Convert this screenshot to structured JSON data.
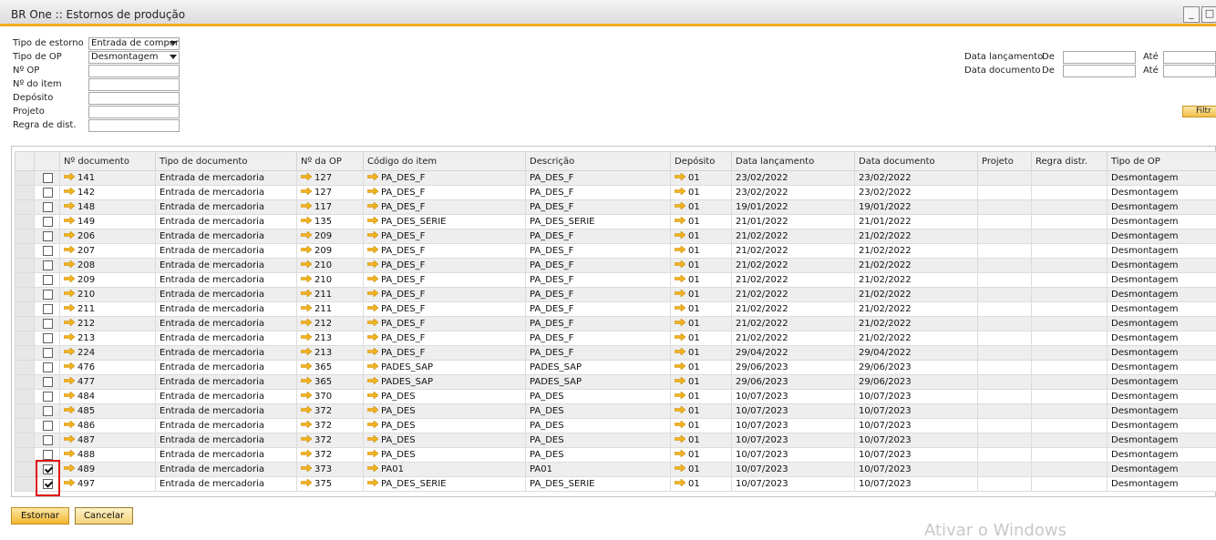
{
  "window": {
    "title": "BR One :: Estornos de produção",
    "minimize_label": "_",
    "maximize_label": "□"
  },
  "form": {
    "tipo_estorno": {
      "label": "Tipo de estorno",
      "value": "Entrada de compor"
    },
    "tipo_op": {
      "label": "Tipo de OP",
      "value": "Desmontagem"
    },
    "num_op": {
      "label": "Nº OP",
      "value": ""
    },
    "num_item": {
      "label": "Nº do item",
      "value": ""
    },
    "deposito": {
      "label": "Depósito",
      "value": ""
    },
    "projeto": {
      "label": "Projeto",
      "value": ""
    },
    "regra_dist": {
      "label": "Regra de dist.",
      "value": ""
    },
    "data_lancamento": {
      "label": "Data lançamento",
      "de": "De",
      "ate": "Até"
    },
    "data_documento": {
      "label": "Data documento",
      "de": "De",
      "ate": "Até"
    },
    "filter_label": "Filtr"
  },
  "grid": {
    "columns": [
      "Nº documento",
      "Tipo de documento",
      "Nº da OP",
      "Código do item",
      "Descrição",
      "Depósito",
      "Data lançamento",
      "Data documento",
      "Projeto",
      "Regra distr.",
      "Tipo de OP"
    ],
    "rows": [
      {
        "checked": false,
        "doc": "141",
        "tipo": "Entrada de mercadoria",
        "op": "127",
        "codigo": "PA_DES_F",
        "descricao": "PA_DES_F",
        "deposito": "01",
        "data_lanc": "23/02/2022",
        "data_doc": "23/02/2022",
        "projeto": "",
        "regra": "",
        "tipo_op": "Desmontagem"
      },
      {
        "checked": false,
        "doc": "142",
        "tipo": "Entrada de mercadoria",
        "op": "127",
        "codigo": "PA_DES_F",
        "descricao": "PA_DES_F",
        "deposito": "01",
        "data_lanc": "23/02/2022",
        "data_doc": "23/02/2022",
        "projeto": "",
        "regra": "",
        "tipo_op": "Desmontagem"
      },
      {
        "checked": false,
        "doc": "148",
        "tipo": "Entrada de mercadoria",
        "op": "117",
        "codigo": "PA_DES_F",
        "descricao": "PA_DES_F",
        "deposito": "01",
        "data_lanc": "19/01/2022",
        "data_doc": "19/01/2022",
        "projeto": "",
        "regra": "",
        "tipo_op": "Desmontagem"
      },
      {
        "checked": false,
        "doc": "149",
        "tipo": "Entrada de mercadoria",
        "op": "135",
        "codigo": "PA_DES_SERIE",
        "descricao": "PA_DES_SERIE",
        "deposito": "01",
        "data_lanc": "21/01/2022",
        "data_doc": "21/01/2022",
        "projeto": "",
        "regra": "",
        "tipo_op": "Desmontagem"
      },
      {
        "checked": false,
        "doc": "206",
        "tipo": "Entrada de mercadoria",
        "op": "209",
        "codigo": "PA_DES_F",
        "descricao": "PA_DES_F",
        "deposito": "01",
        "data_lanc": "21/02/2022",
        "data_doc": "21/02/2022",
        "projeto": "",
        "regra": "",
        "tipo_op": "Desmontagem"
      },
      {
        "checked": false,
        "doc": "207",
        "tipo": "Entrada de mercadoria",
        "op": "209",
        "codigo": "PA_DES_F",
        "descricao": "PA_DES_F",
        "deposito": "01",
        "data_lanc": "21/02/2022",
        "data_doc": "21/02/2022",
        "projeto": "",
        "regra": "",
        "tipo_op": "Desmontagem"
      },
      {
        "checked": false,
        "doc": "208",
        "tipo": "Entrada de mercadoria",
        "op": "210",
        "codigo": "PA_DES_F",
        "descricao": "PA_DES_F",
        "deposito": "01",
        "data_lanc": "21/02/2022",
        "data_doc": "21/02/2022",
        "projeto": "",
        "regra": "",
        "tipo_op": "Desmontagem"
      },
      {
        "checked": false,
        "doc": "209",
        "tipo": "Entrada de mercadoria",
        "op": "210",
        "codigo": "PA_DES_F",
        "descricao": "PA_DES_F",
        "deposito": "01",
        "data_lanc": "21/02/2022",
        "data_doc": "21/02/2022",
        "projeto": "",
        "regra": "",
        "tipo_op": "Desmontagem"
      },
      {
        "checked": false,
        "doc": "210",
        "tipo": "Entrada de mercadoria",
        "op": "211",
        "codigo": "PA_DES_F",
        "descricao": "PA_DES_F",
        "deposito": "01",
        "data_lanc": "21/02/2022",
        "data_doc": "21/02/2022",
        "projeto": "",
        "regra": "",
        "tipo_op": "Desmontagem"
      },
      {
        "checked": false,
        "doc": "211",
        "tipo": "Entrada de mercadoria",
        "op": "211",
        "codigo": "PA_DES_F",
        "descricao": "PA_DES_F",
        "deposito": "01",
        "data_lanc": "21/02/2022",
        "data_doc": "21/02/2022",
        "projeto": "",
        "regra": "",
        "tipo_op": "Desmontagem"
      },
      {
        "checked": false,
        "doc": "212",
        "tipo": "Entrada de mercadoria",
        "op": "212",
        "codigo": "PA_DES_F",
        "descricao": "PA_DES_F",
        "deposito": "01",
        "data_lanc": "21/02/2022",
        "data_doc": "21/02/2022",
        "projeto": "",
        "regra": "",
        "tipo_op": "Desmontagem"
      },
      {
        "checked": false,
        "doc": "213",
        "tipo": "Entrada de mercadoria",
        "op": "213",
        "codigo": "PA_DES_F",
        "descricao": "PA_DES_F",
        "deposito": "01",
        "data_lanc": "21/02/2022",
        "data_doc": "21/02/2022",
        "projeto": "",
        "regra": "",
        "tipo_op": "Desmontagem"
      },
      {
        "checked": false,
        "doc": "224",
        "tipo": "Entrada de mercadoria",
        "op": "213",
        "codigo": "PA_DES_F",
        "descricao": "PA_DES_F",
        "deposito": "01",
        "data_lanc": "29/04/2022",
        "data_doc": "29/04/2022",
        "projeto": "",
        "regra": "",
        "tipo_op": "Desmontagem"
      },
      {
        "checked": false,
        "doc": "476",
        "tipo": "Entrada de mercadoria",
        "op": "365",
        "codigo": "PADES_SAP",
        "descricao": "PADES_SAP",
        "deposito": "01",
        "data_lanc": "29/06/2023",
        "data_doc": "29/06/2023",
        "projeto": "",
        "regra": "",
        "tipo_op": "Desmontagem"
      },
      {
        "checked": false,
        "doc": "477",
        "tipo": "Entrada de mercadoria",
        "op": "365",
        "codigo": "PADES_SAP",
        "descricao": "PADES_SAP",
        "deposito": "01",
        "data_lanc": "29/06/2023",
        "data_doc": "29/06/2023",
        "projeto": "",
        "regra": "",
        "tipo_op": "Desmontagem"
      },
      {
        "checked": false,
        "doc": "484",
        "tipo": "Entrada de mercadoria",
        "op": "370",
        "codigo": "PA_DES",
        "descricao": "PA_DES",
        "deposito": "01",
        "data_lanc": "10/07/2023",
        "data_doc": "10/07/2023",
        "projeto": "",
        "regra": "",
        "tipo_op": "Desmontagem"
      },
      {
        "checked": false,
        "doc": "485",
        "tipo": "Entrada de mercadoria",
        "op": "372",
        "codigo": "PA_DES",
        "descricao": "PA_DES",
        "deposito": "01",
        "data_lanc": "10/07/2023",
        "data_doc": "10/07/2023",
        "projeto": "",
        "regra": "",
        "tipo_op": "Desmontagem"
      },
      {
        "checked": false,
        "doc": "486",
        "tipo": "Entrada de mercadoria",
        "op": "372",
        "codigo": "PA_DES",
        "descricao": "PA_DES",
        "deposito": "01",
        "data_lanc": "10/07/2023",
        "data_doc": "10/07/2023",
        "projeto": "",
        "regra": "",
        "tipo_op": "Desmontagem"
      },
      {
        "checked": false,
        "doc": "487",
        "tipo": "Entrada de mercadoria",
        "op": "372",
        "codigo": "PA_DES",
        "descricao": "PA_DES",
        "deposito": "01",
        "data_lanc": "10/07/2023",
        "data_doc": "10/07/2023",
        "projeto": "",
        "regra": "",
        "tipo_op": "Desmontagem"
      },
      {
        "checked": false,
        "doc": "488",
        "tipo": "Entrada de mercadoria",
        "op": "372",
        "codigo": "PA_DES",
        "descricao": "PA_DES",
        "deposito": "01",
        "data_lanc": "10/07/2023",
        "data_doc": "10/07/2023",
        "projeto": "",
        "regra": "",
        "tipo_op": "Desmontagem"
      },
      {
        "checked": true,
        "doc": "489",
        "tipo": "Entrada de mercadoria",
        "op": "373",
        "codigo": "PA01",
        "descricao": "PA01",
        "deposito": "01",
        "data_lanc": "10/07/2023",
        "data_doc": "10/07/2023",
        "projeto": "",
        "regra": "",
        "tipo_op": "Desmontagem"
      },
      {
        "checked": true,
        "doc": "497",
        "tipo": "Entrada de mercadoria",
        "op": "375",
        "codigo": "PA_DES_SERIE",
        "descricao": "PA_DES_SERIE",
        "deposito": "01",
        "data_lanc": "10/07/2023",
        "data_doc": "10/07/2023",
        "projeto": "",
        "regra": "",
        "tipo_op": "Desmontagem"
      }
    ]
  },
  "buttons": {
    "estornar": "Estornar",
    "cancelar": "Cancelar"
  },
  "icons": {
    "link_arrow": "link-arrow-icon",
    "link_arrow_color": "#f2b31d"
  },
  "watermark": "Ativar o Windows"
}
